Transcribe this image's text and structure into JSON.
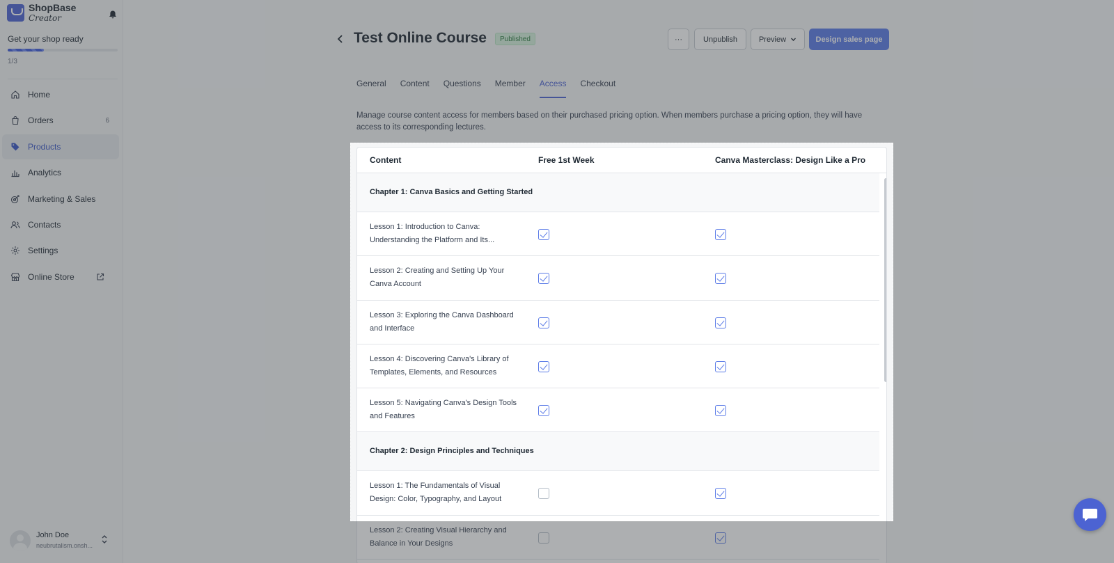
{
  "sidebar": {
    "logo_main": "ShopBase",
    "logo_sub": "Creator",
    "setup_title": "Get your shop ready",
    "setup_progress": 0.33,
    "setup_count": "1/3",
    "items": [
      {
        "label": "Home",
        "icon": "home-icon",
        "badge": ""
      },
      {
        "label": "Orders",
        "icon": "orders-icon",
        "badge": "6"
      },
      {
        "label": "Products",
        "icon": "tag-icon",
        "badge": "",
        "active": true
      },
      {
        "label": "Analytics",
        "icon": "analytics-icon",
        "badge": ""
      },
      {
        "label": "Marketing & Sales",
        "icon": "marketing-icon",
        "badge": ""
      },
      {
        "label": "Contacts",
        "icon": "contacts-icon",
        "badge": ""
      },
      {
        "label": "Settings",
        "icon": "gear-icon",
        "badge": ""
      },
      {
        "label": "Online Store",
        "icon": "store-icon",
        "badge": ""
      }
    ],
    "user_name": "John Doe",
    "user_email": "neubrutalism.onsh..."
  },
  "header": {
    "title": "Test Online Course",
    "status": "Published",
    "more_label": "···",
    "unpublish_label": "Unpublish",
    "preview_label": "Preview",
    "design_label": "Design sales page"
  },
  "tabs": [
    "General",
    "Content",
    "Questions",
    "Member",
    "Access",
    "Checkout"
  ],
  "active_tab": "Access",
  "description": "Manage course content access for members based on their purchased pricing option. When members purchase a pricing option, they will have access to its corresponding lectures.",
  "table": {
    "columns": [
      "Content",
      "Free 1st Week",
      "Canva Masterclass: Design Like a Pro"
    ],
    "rows": [
      {
        "type": "chapter",
        "title": "Chapter 1: Canva Basics and Getting Started"
      },
      {
        "type": "lesson",
        "title": "Lesson 1: Introduction to Canva: Understanding the Platform and Its...",
        "free": true,
        "pro": true
      },
      {
        "type": "lesson",
        "title": "Lesson 2: Creating and Setting Up Your Canva Account",
        "free": true,
        "pro": true
      },
      {
        "type": "lesson",
        "title": "Lesson 3: Exploring the Canva Dashboard and Interface",
        "free": true,
        "pro": true
      },
      {
        "type": "lesson",
        "title": "Lesson 4: Discovering Canva's Library of Templates, Elements, and Resources",
        "free": true,
        "pro": true
      },
      {
        "type": "lesson",
        "title": "Lesson 5: Navigating Canva's Design Tools and Features",
        "free": true,
        "pro": true
      },
      {
        "type": "chapter",
        "title": "Chapter 2: Design Principles and Techniques"
      },
      {
        "type": "lesson",
        "title": "Lesson 1: The Fundamentals of Visual Design: Color, Typography, and Layout",
        "free": false,
        "pro": true
      },
      {
        "type": "lesson",
        "title": "Lesson 2: Creating Visual Hierarchy and Balance in Your Designs",
        "free": false,
        "pro": true
      }
    ]
  },
  "colors": {
    "accent": "#4c63d2",
    "primary_button": "#5b7be7",
    "published_bg": "#d6f2dc",
    "published_text": "#2f7d43"
  }
}
